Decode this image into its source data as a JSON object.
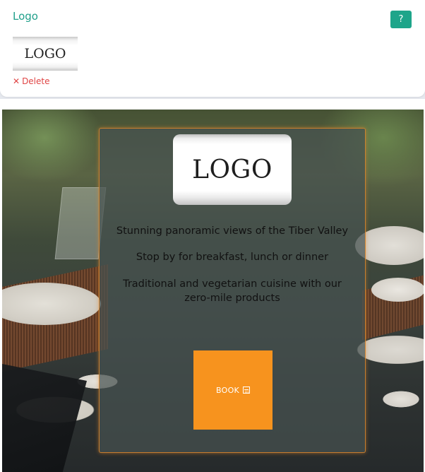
{
  "panel": {
    "title": "Logo",
    "help_label": "?",
    "logo_thumbnail_text": "LOGO",
    "delete_label": "Delete",
    "delete_icon": "✕"
  },
  "preview": {
    "logo_text": "LOGO",
    "taglines": [
      "Stunning panoramic views of the Tiber Valley",
      "Stop by for breakfast, lunch or dinner",
      "Traditional and vegetarian cuisine with our zero-mile products"
    ],
    "book_label": "BOOK",
    "book_icon": "calendar-icon"
  },
  "colors": {
    "accent_teal": "#1ea58a",
    "delete_red": "#e04646",
    "book_orange": "#f7931e"
  }
}
